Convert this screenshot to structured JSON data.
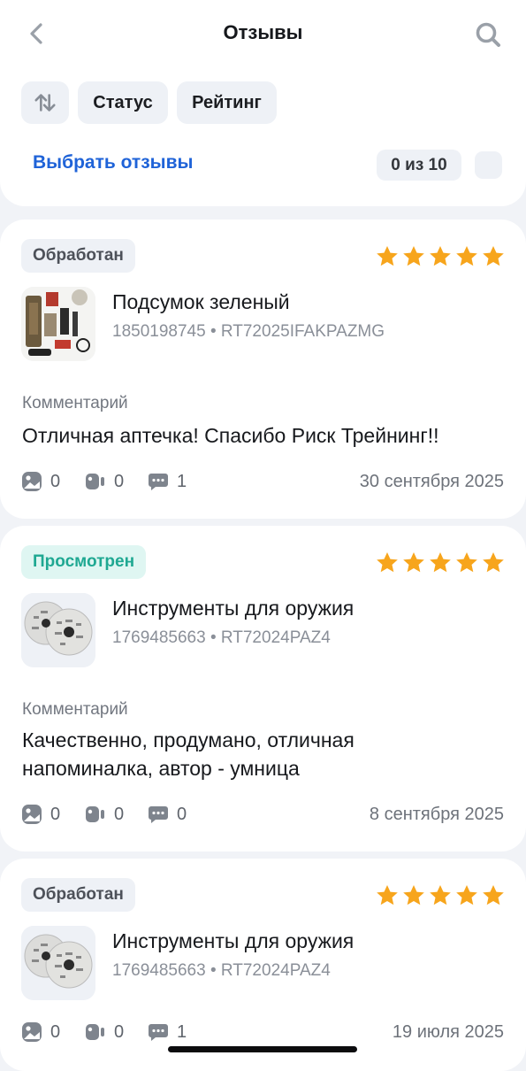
{
  "header": {
    "title": "Отзывы",
    "back_icon": "chevron-left-icon",
    "search_icon": "search-icon"
  },
  "filters": {
    "sort_icon": "sort-arrows-icon",
    "status_label": "Статус",
    "rating_label": "Рейтинг"
  },
  "selection": {
    "select_label": "Выбрать отзывы",
    "counter": "0 из 10"
  },
  "colors": {
    "accent_blue": "#1f63d8",
    "star": "#f7a51c",
    "viewed_green": "#1fa892",
    "viewed_bg": "#dff6f2",
    "chip_bg": "#eef1f6",
    "page_bg": "#f1f3f7"
  },
  "reviews": [
    {
      "status": "Обработан",
      "rating": 5,
      "product_name": "Подсумок зеленый",
      "product_code": "1850198745 • RT72025IFAKPAZMG",
      "comment_label": "Комментарий",
      "comment": "Отличная аптечка! Спасибо Риск Трейнинг!!",
      "photos": "0",
      "videos": "0",
      "replies": "1",
      "date": "30 сентября 2025"
    },
    {
      "status": "Просмотрен",
      "rating": 5,
      "product_name": "Инструменты для оружия",
      "product_code": "1769485663 • RT72024PAZ4",
      "comment_label": "Комментарий",
      "comment": "Качественно, продумано, отличная напоминалка, автор - умница",
      "photos": "0",
      "videos": "0",
      "replies": "0",
      "date": "8 сентября 2025"
    },
    {
      "status": "Обработан",
      "rating": 5,
      "product_name": "Инструменты для оружия",
      "product_code": "1769485663 • RT72024PAZ4",
      "photos": "0",
      "videos": "0",
      "replies": "1",
      "date": "19 июля 2025"
    }
  ]
}
